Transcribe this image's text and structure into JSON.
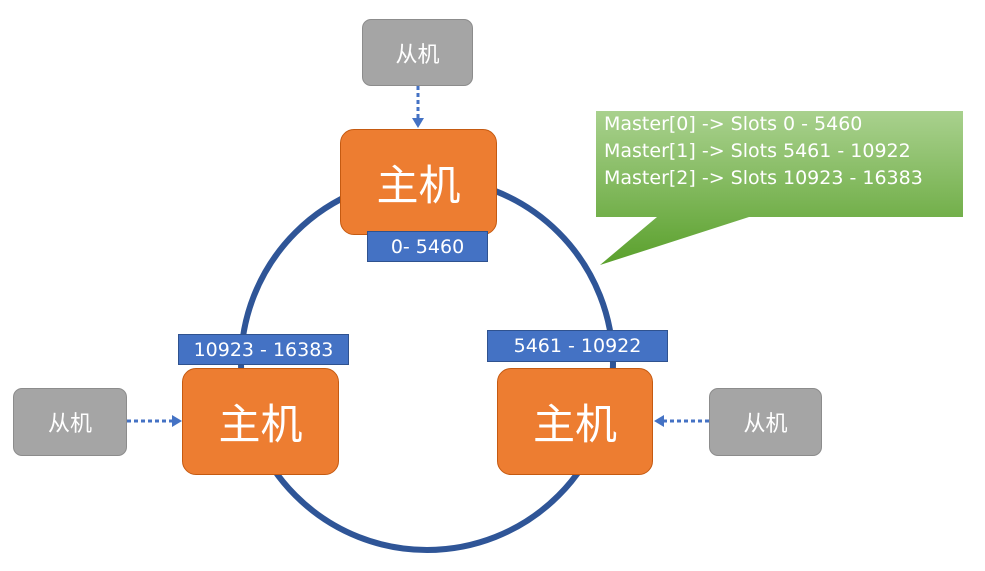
{
  "colors": {
    "ring": "#2f5597",
    "master": "#ed7d31",
    "slave": "#a5a5a5",
    "slot_label": "#4472c4",
    "arrow": "#4472c4",
    "callout_top": "#a9d18e",
    "callout_bottom": "#5aa02c"
  },
  "masters": {
    "top": "主机",
    "left": "主机",
    "right": "主机"
  },
  "slaves": {
    "top": "从机",
    "left": "从机",
    "right": "从机"
  },
  "slots": {
    "top": "0- 5460",
    "left": "10923 - 16383",
    "right": "5461 - 10922"
  },
  "callout": {
    "lines": [
      "Master[0] -> Slots 0 - 5460",
      "Master[1] -> Slots 5461 - 10922",
      "Master[2] -> Slots 10923 - 16383"
    ]
  }
}
